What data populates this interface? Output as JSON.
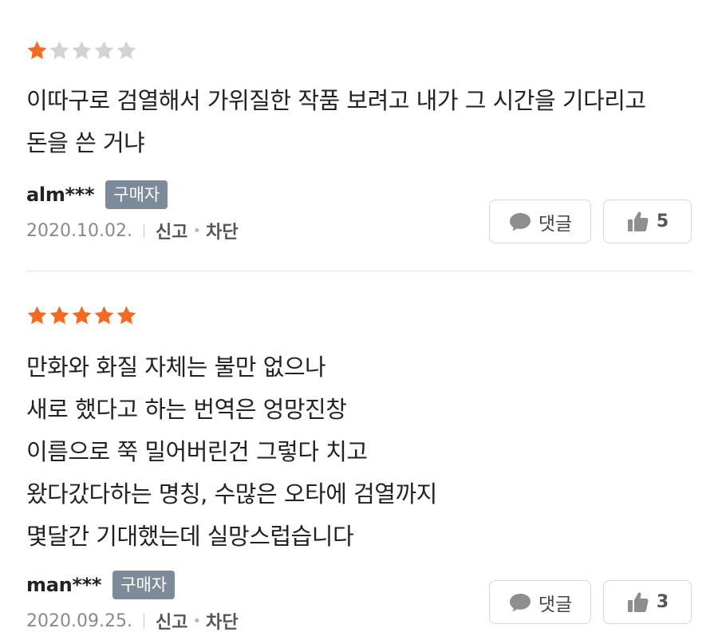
{
  "colors": {
    "star_on": "#f26b21",
    "star_off": "#d3d3d3",
    "badge_bg": "#7d8a99"
  },
  "reviews": [
    {
      "rating": 1,
      "max_rating": 5,
      "text": "이따구로 검열해서 가위질한 작품 보려고 내가 그 시간을 기다리고\n돈을 쓴 거냐",
      "username": "alm***",
      "badge": "구매자",
      "date": "2020.10.02.",
      "report_label": "신고",
      "block_label": "차단",
      "comment_label": "댓글",
      "like_icon": "thumbs-up-icon",
      "comment_icon": "speech-bubble-icon",
      "likes": "5"
    },
    {
      "rating": 5,
      "max_rating": 5,
      "text": "만화와 화질 자체는 불만 없으나\n새로 했다고 하는 번역은 엉망진창\n이름으로 쭉 밀어버린건 그렇다 치고\n왔다갔다하는 명칭, 수많은 오타에 검열까지\n몇달간 기대했는데 실망스럽습니다",
      "username": "man***",
      "badge": "구매자",
      "date": "2020.09.25.",
      "report_label": "신고",
      "block_label": "차단",
      "comment_label": "댓글",
      "like_icon": "thumbs-up-icon",
      "comment_icon": "speech-bubble-icon",
      "likes": "3"
    }
  ]
}
